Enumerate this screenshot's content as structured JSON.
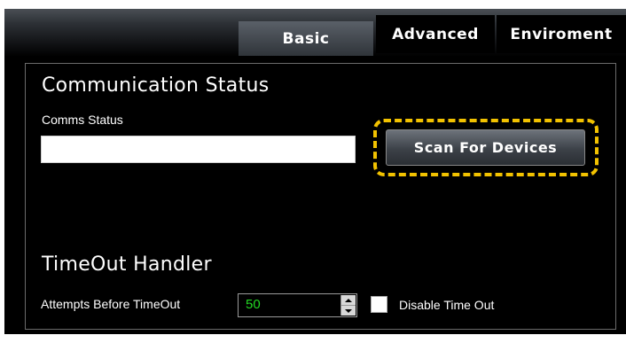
{
  "tabs": [
    {
      "label": "Basic",
      "active": true
    },
    {
      "label": "Advanced",
      "active": false
    },
    {
      "label": "Enviroment",
      "active": false
    }
  ],
  "communication": {
    "heading": "Communication Status",
    "comms_label": "Comms Status",
    "comms_value": "",
    "scan_button": "Scan For Devices"
  },
  "timeout": {
    "heading": "TimeOut Handler",
    "attempts_label": "Attempts Before TimeOut",
    "attempts_value": "50",
    "disable_label": "Disable Time Out",
    "disable_checked": false
  },
  "colors": {
    "highlight": "#f2c200",
    "value_text": "#22d822",
    "panel_bg": "#000000"
  }
}
